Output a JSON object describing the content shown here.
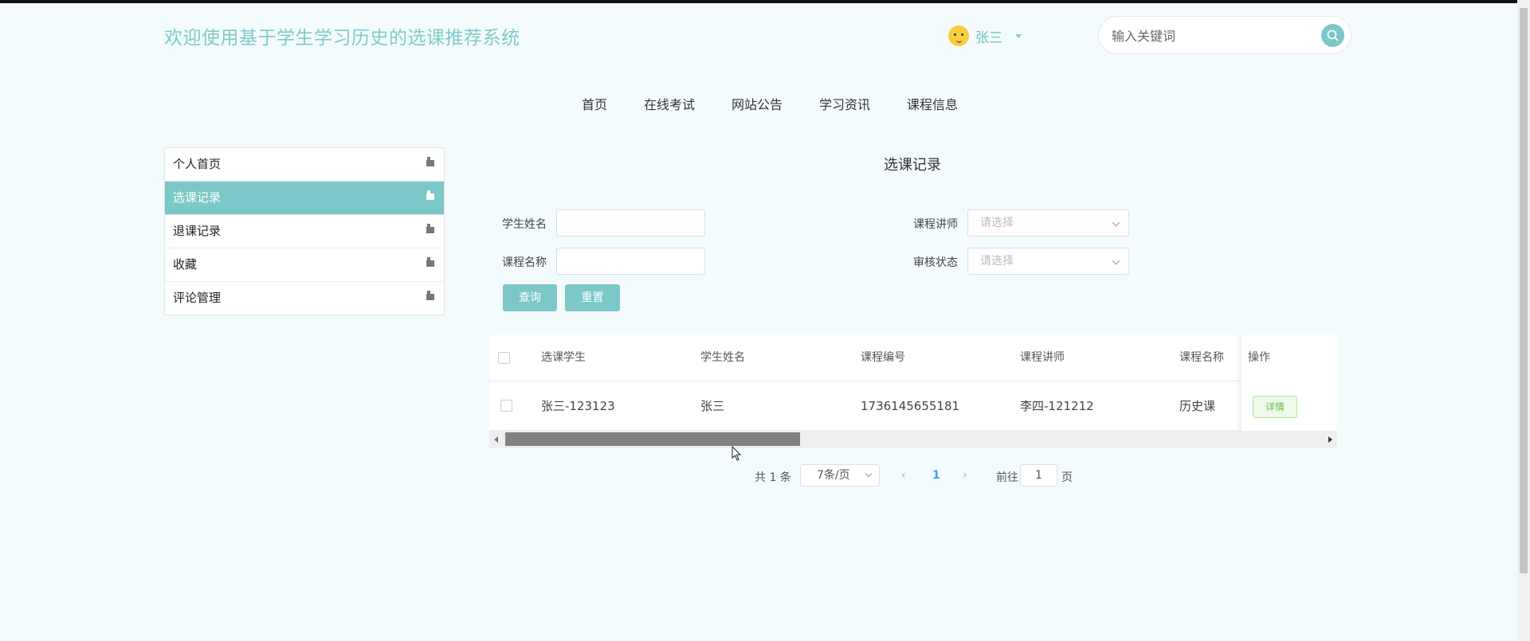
{
  "header": {
    "site_title": "欢迎使用基于学生学习历史的选课推荐系统",
    "username": "张三",
    "search_placeholder": "输入关键词"
  },
  "nav": {
    "items": [
      "首页",
      "在线考试",
      "网站公告",
      "学习资讯",
      "课程信息"
    ]
  },
  "sidebar": {
    "items": [
      {
        "label": "个人首页",
        "active": false
      },
      {
        "label": "选课记录",
        "active": true
      },
      {
        "label": "退课记录",
        "active": false
      },
      {
        "label": "收藏",
        "active": false
      },
      {
        "label": "评论管理",
        "active": false
      }
    ]
  },
  "main": {
    "title": "选课记录",
    "filters": {
      "student_name_label": "学生姓名",
      "student_name_value": "",
      "course_name_label": "课程名称",
      "course_name_value": "",
      "teacher_label": "课程讲师",
      "teacher_placeholder": "请选择",
      "status_label": "审核状态",
      "status_placeholder": "请选择"
    },
    "buttons": {
      "query": "查询",
      "reset": "重置"
    },
    "table": {
      "columns": [
        "选课学生",
        "学生姓名",
        "课程编号",
        "课程讲师",
        "课程名称",
        "操作"
      ],
      "rows": [
        [
          "张三-123123",
          "张三",
          "1736145655181",
          "李四-121212",
          "历史课",
          "详情"
        ]
      ]
    },
    "pagination": {
      "total": "共 1 条",
      "page_size": "7条/页",
      "current_page": "1",
      "goto_prefix": "前往",
      "goto_value": "1",
      "goto_suffix": "页"
    }
  },
  "colors": {
    "accent": "#7cc8c8",
    "background": "#f4fbfd",
    "title": "#7fcbcb"
  }
}
